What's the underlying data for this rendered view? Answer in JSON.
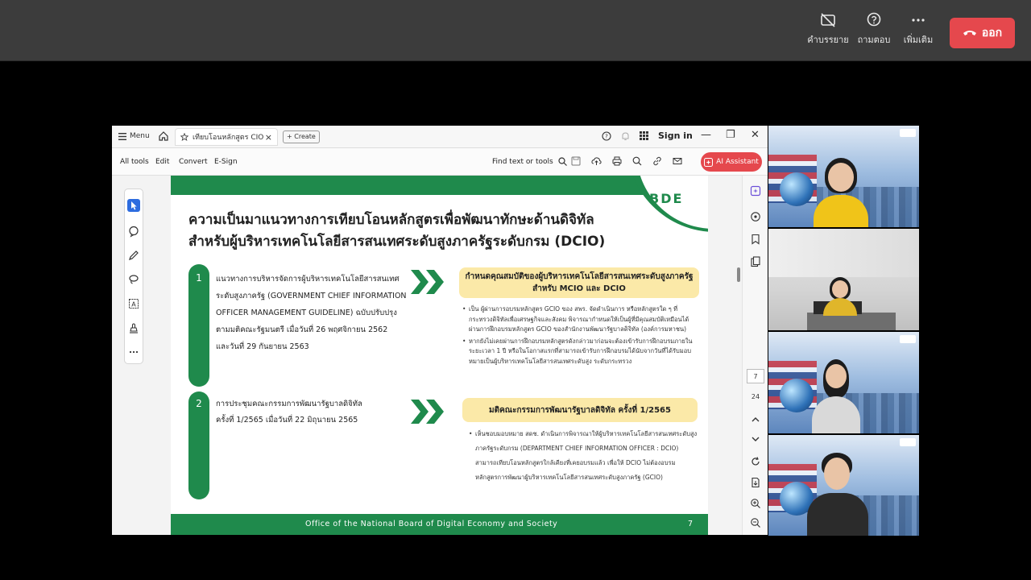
{
  "meeting": {
    "buttons": [
      {
        "label": "คำบรรยาย",
        "icon": "captions-off-icon"
      },
      {
        "label": "ถามตอบ",
        "icon": "qa-icon"
      },
      {
        "label": "เพิ่มเติม",
        "icon": "more-icon"
      }
    ],
    "leave_label": "ออก"
  },
  "acrobat": {
    "menu_label": "Menu",
    "tab_title": "เทียบโอนหลักสูตร CIO",
    "create_label": "+ Create",
    "signin_label": "Sign in",
    "toolbar_items": [
      "All tools",
      "Edit",
      "Convert",
      "E-Sign"
    ],
    "find_label": "Find text or tools",
    "ai_label": "AI Assistant",
    "page_current": "7",
    "page_total": "24"
  },
  "slide": {
    "logo": "BDE",
    "title_line1": "ความเป็นมาแนวทางการเทียบโอนหลักสูตรเพื่อพัฒนาทักษะด้านดิจิทัล",
    "title_line2": "สำหรับผู้บริหารเทคโนโลยีสารสนเทศระดับสูงภาครัฐระดับกรม (DCIO)",
    "items": [
      {
        "num": "1",
        "lines": [
          "แนวทางการบริหารจัดการผู้บริหารเทคโนโลยีสารสนเทศ",
          "ระดับสูงภาครัฐ (GOVERNMENT CHIEF INFORMATION",
          "OFFICER MANAGEMENT GUIDELINE) ฉบับปรับปรุง",
          "ตามมติคณะรัฐมนตรี เมื่อวันที่ 26 พฤศจิกายน 2562",
          "และวันที่ 29 กันยายน 2563"
        ]
      },
      {
        "num": "2",
        "lines": [
          "การประชุมคณะกรรมการพัฒนารัฐบาลดิจิทัล",
          "ครั้งที่ 1/2565 เมื่อวันที่ 22 มิถุนายน 2565"
        ]
      }
    ],
    "box1_line1": "กำหนดคุณสมบัติของผู้บริหารเทคโนโลยีสารสนเทศระดับสูงภาครัฐ",
    "box1_line2": "สำหรับ MCIO และ DCIO",
    "box1_bullets": [
      "เป็น ผู้ผ่านการอบรมหลักสูตร GCIO ของ สพร. จัดดำเนินการ หรือหลักสูตรใด ๆ ที่กระทรวงดิจิทัลเพื่อเศรษฐกิจและสังคม พิจารณากำหนดให้เป็นผู้ที่มีคุณสมบัติเหมือนได้ผ่านการฝึกอบรมหลักสูตร GCIO ของสำนักงานพัฒนารัฐบาลดิจิทัล (องค์การมหาชน)",
      "หากยังไม่เคยผ่านการฝึกอบรมหลักสูตรดังกล่าวมาก่อนจะต้องเข้ารับการฝึกอบรมภายในระยะเวลา 1 ปี หรือในโอกาสแรกที่สามารถเข้ารับการฝึกอบรมได้นับจากวันที่ได้รับมอบหมายเป็นผู้บริหารเทคโนโลยีสารสนเทศระดับสูง ระดับกระทรวง"
    ],
    "box2_title": "มติคณะกรรมการพัฒนารัฐบาลดิจิทัล ครั้งที่ 1/2565",
    "box2_bullets": [
      "เห็นชอบมอบหมาย สดช. ดำเนินการพิจารณาให้ผู้บริหารเทคโนโลยีสารสนเทศระดับสูงภาครัฐระดับกรม (DEPARTMENT CHIEF INFORMATION OFFICER : DCIO) สามารถเทียบโอนหลักสูตรใกล้เคียงที่เคยอบรมแล้ว เพื่อให้ DCIO ไม่ต้องอบรมหลักสูตรการพัฒนาผู้บริหารเทคโนโลยีสารสนเทศระดับสูงภาครัฐ (GCIO)"
    ],
    "footer_text": "Office of the National Board of Digital Economy and Society",
    "page_number": "7"
  },
  "colors": {
    "slide_green": "#1f8a4c",
    "slide_yellow": "#fbe9a8",
    "leave_red": "#e5484d"
  }
}
